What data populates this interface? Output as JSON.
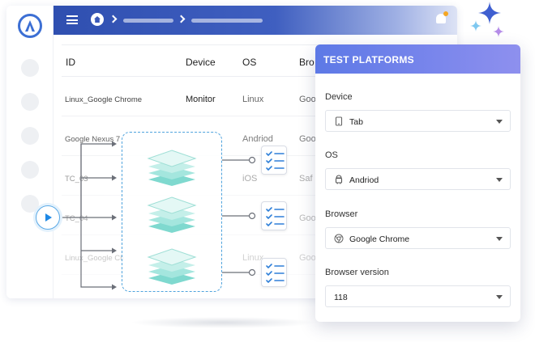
{
  "table": {
    "headers": [
      "ID",
      "Device",
      "OS",
      "Bro"
    ],
    "rows": [
      {
        "id": "Linux_Google Chrome",
        "device": "Monitor",
        "os": "Linux",
        "browser": "Goo"
      },
      {
        "id": "Google Nexus 7",
        "device": "",
        "os": "Andriod",
        "browser": "Goo"
      },
      {
        "id": "TC_03",
        "device": "",
        "os": "iOS",
        "browser": "Saf"
      },
      {
        "id": "TC_04",
        "device": "",
        "os": "",
        "browser": "Goo"
      },
      {
        "id": "Linux_Google Ch",
        "device": "",
        "os": "Linux",
        "browser": "Goo"
      }
    ]
  },
  "panel": {
    "title": "TEST PLATFORMS",
    "fields": [
      {
        "label": "Device",
        "value": "Tab",
        "icon": "tablet-icon"
      },
      {
        "label": "OS",
        "value": "Andriod",
        "icon": "android-icon"
      },
      {
        "label": "Browser",
        "value": "Google Chrome",
        "icon": "chrome-icon"
      },
      {
        "label": "Browser version",
        "value": "118",
        "icon": ""
      }
    ]
  },
  "colors": {
    "topbar": "#2f4fb0",
    "panel_header": "#6a7fe8",
    "accent": "#4fa3dd",
    "layers": "#8fe0d8"
  }
}
